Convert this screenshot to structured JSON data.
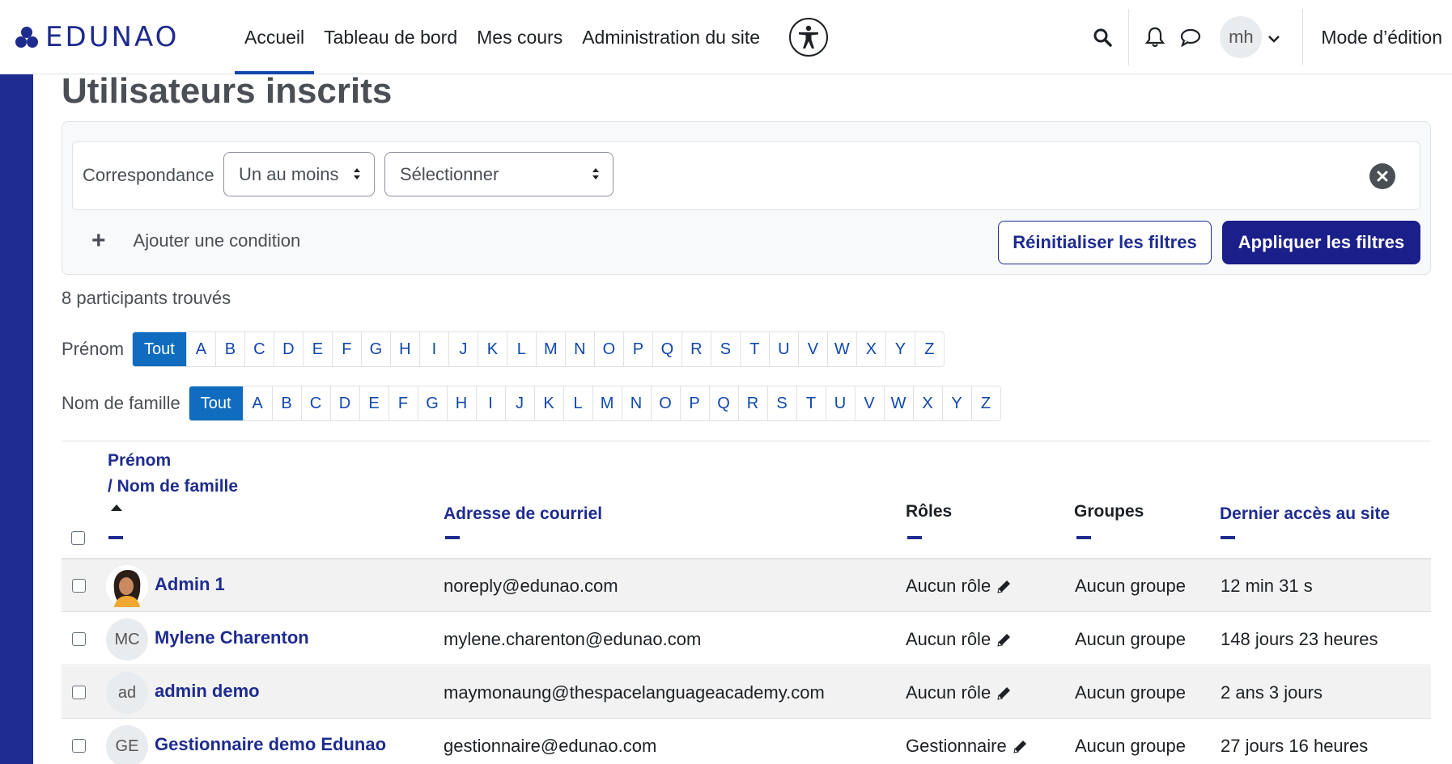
{
  "brand": {
    "name": "EDUNAO"
  },
  "nav": {
    "links": [
      "Accueil",
      "Tableau de bord",
      "Mes cours",
      "Administration du site"
    ],
    "user_initials": "mh",
    "edit_mode_label": "Mode d’édition"
  },
  "page": {
    "title": "Utilisateurs inscrits"
  },
  "filters": {
    "match_label": "Correspondance",
    "match_value": "Un au moins",
    "type_value": "Sélectionner",
    "add_condition": "Ajouter une condition",
    "reset_label": "Réinitialiser les filtres",
    "apply_label": "Appliquer les filtres"
  },
  "found_text": "8 participants trouvés",
  "initials_bar": {
    "firstname_label": "Prénom",
    "lastname_label": "Nom de famille",
    "all_label": "Tout",
    "letters": [
      "A",
      "B",
      "C",
      "D",
      "E",
      "F",
      "G",
      "H",
      "I",
      "J",
      "K",
      "L",
      "M",
      "N",
      "O",
      "P",
      "Q",
      "R",
      "S",
      "T",
      "U",
      "V",
      "W",
      "X",
      "Y",
      "Z"
    ]
  },
  "table": {
    "headers": {
      "firstname": "Prénom",
      "lastname": "/ Nom de famille",
      "email": "Adresse de courriel",
      "roles": "Rôles",
      "groups": "Groupes",
      "last_access": "Dernier accès au site"
    },
    "rows": [
      {
        "avatar": "",
        "name": "Admin 1",
        "email": "noreply@edunao.com",
        "role": "Aucun rôle",
        "group": "Aucun groupe",
        "last_access": "12 min 31 s"
      },
      {
        "avatar": "MC",
        "name": "Mylene Charenton",
        "email": "mylene.charenton@edunao.com",
        "role": "Aucun rôle",
        "group": "Aucun groupe",
        "last_access": "148 jours 23 heures"
      },
      {
        "avatar": "ad",
        "name": "admin demo",
        "email": "maymonaung@thespacelanguageacademy.com",
        "role": "Aucun rôle",
        "group": "Aucun groupe",
        "last_access": "2 ans 3 jours"
      },
      {
        "avatar": "GE",
        "name": "Gestionnaire demo Edunao",
        "email": "gestionnaire@edunao.com",
        "role": "Gestionnaire",
        "group": "Aucun groupe",
        "last_access": "27 jours 16 heures"
      }
    ]
  },
  "colors": {
    "brand": "#1e2c8f",
    "link": "#0f47ad",
    "active_letter": "#0f6cbf"
  }
}
